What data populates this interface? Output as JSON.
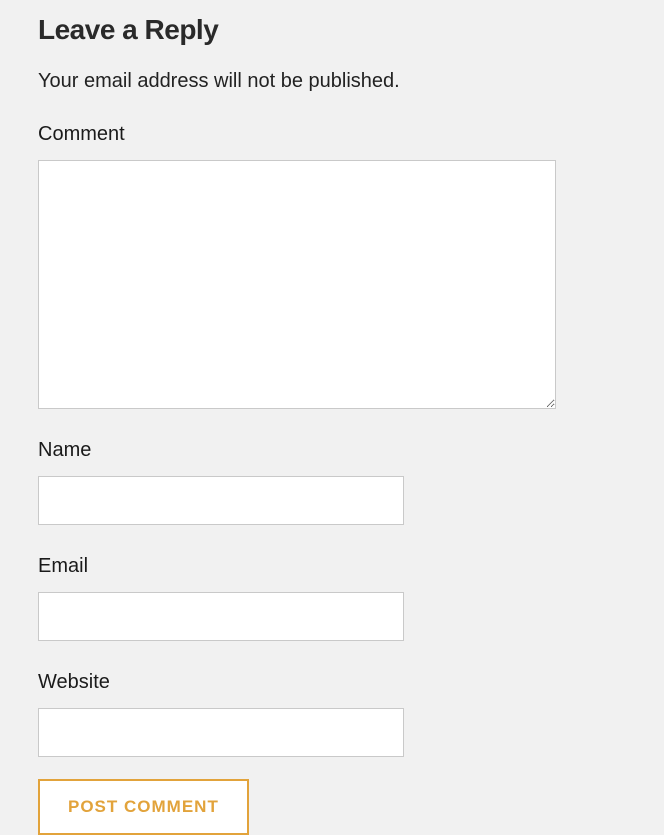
{
  "form": {
    "title": "Leave a Reply",
    "notice": "Your email address will not be published.",
    "fields": {
      "comment": {
        "label": "Comment",
        "value": ""
      },
      "name": {
        "label": "Name",
        "value": ""
      },
      "email": {
        "label": "Email",
        "value": ""
      },
      "website": {
        "label": "Website",
        "value": ""
      }
    },
    "submit_label": "POST COMMENT"
  }
}
